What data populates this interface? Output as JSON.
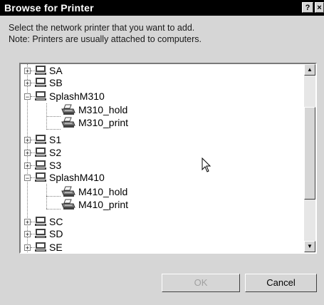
{
  "window": {
    "title": "Browse for Printer",
    "help_glyph": "?",
    "close_glyph": "×"
  },
  "description": {
    "line1": "Select the network printer that you want to add.",
    "line2": "Note: Printers are usually attached to computers."
  },
  "tree": {
    "items": [
      {
        "label": "SA",
        "type": "computer",
        "expander": "+"
      },
      {
        "label": "SB",
        "type": "computer",
        "expander": "+"
      },
      {
        "label": "SplashM310",
        "type": "computer",
        "expander": "−"
      },
      {
        "label": "M310_hold",
        "type": "printer"
      },
      {
        "label": "M310_print",
        "type": "printer"
      },
      {
        "label": "S1",
        "type": "computer",
        "expander": "+"
      },
      {
        "label": "S2",
        "type": "computer",
        "expander": "+"
      },
      {
        "label": "S3",
        "type": "computer",
        "expander": "+"
      },
      {
        "label": "SplashM410",
        "type": "computer",
        "expander": "−"
      },
      {
        "label": "M410_hold",
        "type": "printer"
      },
      {
        "label": "M410_print",
        "type": "printer"
      },
      {
        "label": "SC",
        "type": "computer",
        "expander": "+"
      },
      {
        "label": "SD",
        "type": "computer",
        "expander": "+"
      },
      {
        "label": "SE",
        "type": "computer",
        "expander": "+"
      }
    ],
    "scroll_up_glyph": "▲",
    "scroll_down_glyph": "▼"
  },
  "buttons": {
    "ok_label": "OK",
    "cancel_label": "Cancel"
  }
}
